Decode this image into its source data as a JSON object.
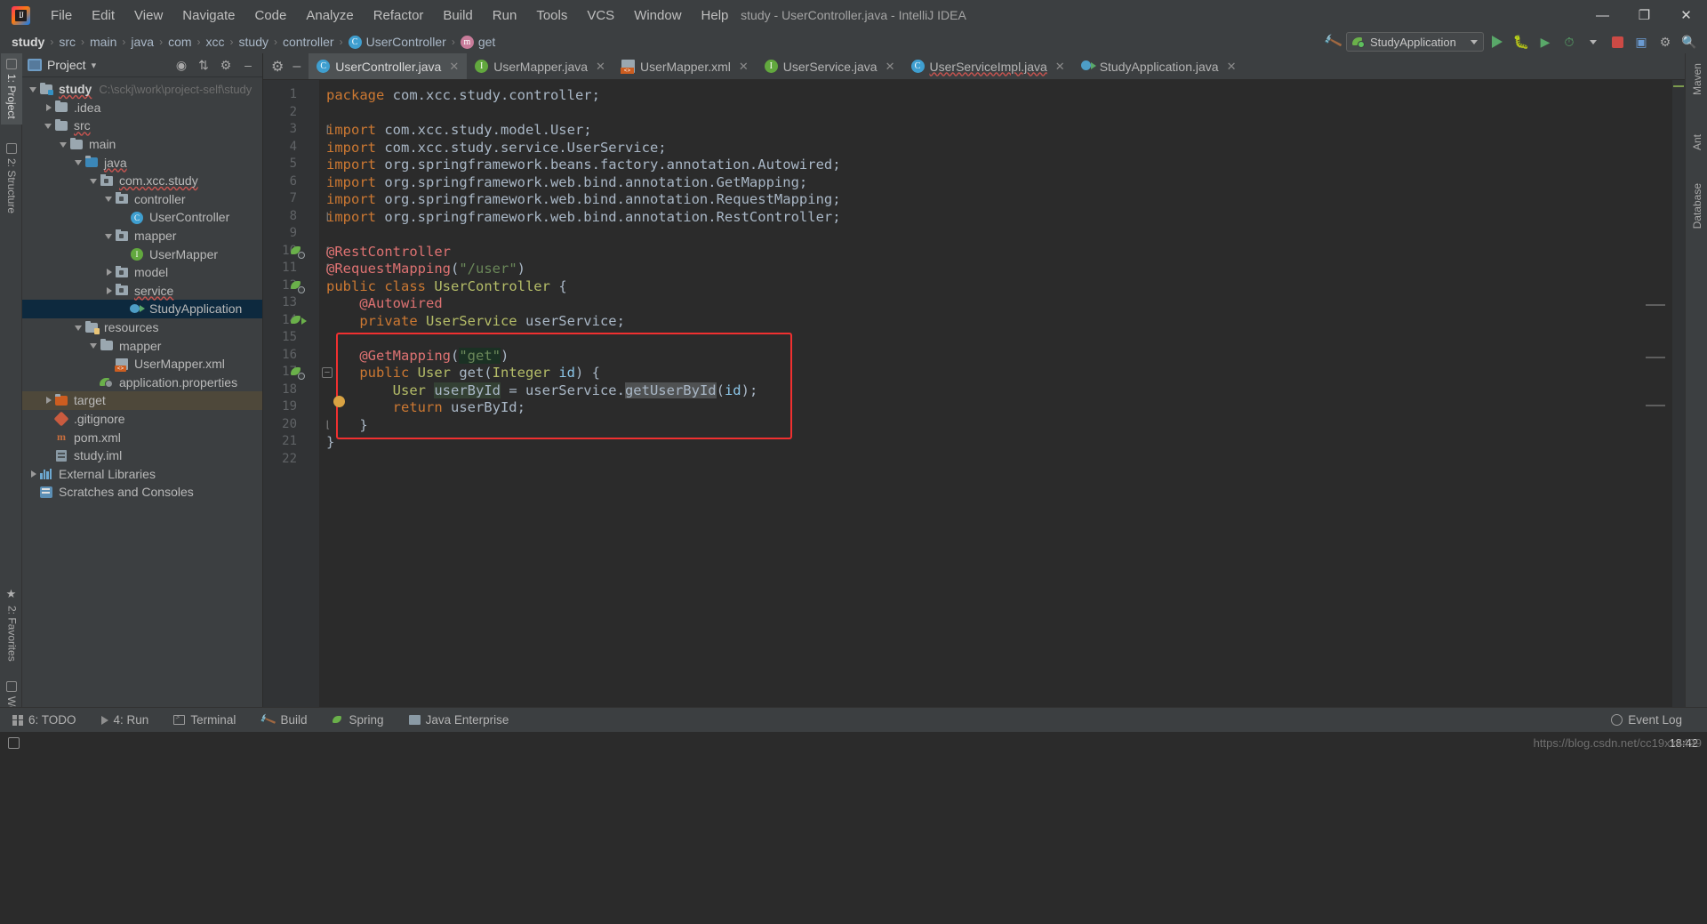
{
  "window": {
    "title": "study - UserController.java - IntelliJ IDEA",
    "logo_text": "IJ",
    "minimize": "—",
    "maximize": "❐",
    "close": "✕"
  },
  "menu": [
    {
      "label": "File"
    },
    {
      "label": "Edit"
    },
    {
      "label": "View"
    },
    {
      "label": "Navigate"
    },
    {
      "label": "Code"
    },
    {
      "label": "Analyze"
    },
    {
      "label": "Refactor"
    },
    {
      "label": "Build"
    },
    {
      "label": "Run"
    },
    {
      "label": "Tools"
    },
    {
      "label": "VCS"
    },
    {
      "label": "Window"
    },
    {
      "label": "Help"
    }
  ],
  "breadcrumb": {
    "separator": "›",
    "items": [
      {
        "label": "study",
        "icon": ""
      },
      {
        "label": "src",
        "icon": ""
      },
      {
        "label": "main",
        "icon": ""
      },
      {
        "label": "java",
        "icon": ""
      },
      {
        "label": "com",
        "icon": ""
      },
      {
        "label": "xcc",
        "icon": ""
      },
      {
        "label": "study",
        "icon": ""
      },
      {
        "label": "controller",
        "icon": ""
      },
      {
        "label": "UserController",
        "icon": "class-icon",
        "badge": "C"
      },
      {
        "label": "get",
        "icon": "method-icon",
        "badge": "m"
      }
    ]
  },
  "toolbar": {
    "build_hammer": "build-icon",
    "run_config": "StudyApplication",
    "run_label": "run-button",
    "debug_label": "debug-button",
    "coverage_label": "run-with-coverage-button",
    "profiler_label": "profiler-button",
    "stop_label": "stop-button",
    "updates_label": "update-button",
    "settings_label": "settings-button",
    "search_label": "search-everywhere-button"
  },
  "rails": {
    "left": [
      {
        "label": "1: Project",
        "active": true
      },
      {
        "label": "2: Structure",
        "active": false
      },
      {
        "label": "2: Favorites",
        "active": false
      },
      {
        "label": "Web",
        "active": false
      }
    ],
    "right": [
      {
        "label": "Maven",
        "active": false
      },
      {
        "label": "Ant",
        "active": false
      },
      {
        "label": "Database",
        "active": false
      }
    ]
  },
  "project_panel": {
    "title": "Project",
    "chevron": "▾",
    "actions": [
      "locate-icon",
      "collapse-all-icon",
      "settings-icon",
      "hide-icon"
    ],
    "tree": [
      {
        "indent": 0,
        "arrow": "open",
        "icon": "folder-module",
        "label": "study",
        "bold": true,
        "path": "C:\\sckj\\work\\project-self\\study",
        "wavy": true
      },
      {
        "indent": 1,
        "arrow": "closed",
        "icon": "folder",
        "label": ".idea"
      },
      {
        "indent": 1,
        "arrow": "open",
        "icon": "folder",
        "label": "src",
        "wavy": true
      },
      {
        "indent": 2,
        "arrow": "open",
        "icon": "folder",
        "label": "main"
      },
      {
        "indent": 3,
        "arrow": "open",
        "icon": "folder-source",
        "label": "java",
        "wavy": true
      },
      {
        "indent": 4,
        "arrow": "open",
        "icon": "package",
        "label": "com.xcc.study",
        "wavy": true
      },
      {
        "indent": 5,
        "arrow": "open",
        "icon": "package",
        "label": "controller"
      },
      {
        "indent": 6,
        "arrow": "none",
        "icon": "class",
        "label": "UserController"
      },
      {
        "indent": 5,
        "arrow": "open",
        "icon": "package",
        "label": "mapper"
      },
      {
        "indent": 6,
        "arrow": "none",
        "icon": "interface",
        "label": "UserMapper"
      },
      {
        "indent": 5,
        "arrow": "closed",
        "icon": "package",
        "label": "model"
      },
      {
        "indent": 5,
        "arrow": "closed",
        "icon": "package",
        "label": "service",
        "wavy": true
      },
      {
        "indent": 6,
        "arrow": "none",
        "icon": "spring-run",
        "label": "StudyApplication",
        "selected": true
      },
      {
        "indent": 3,
        "arrow": "open",
        "icon": "folder-resources",
        "label": "resources"
      },
      {
        "indent": 4,
        "arrow": "open",
        "icon": "folder",
        "label": "mapper"
      },
      {
        "indent": 5,
        "arrow": "none",
        "icon": "xml",
        "label": "UserMapper.xml"
      },
      {
        "indent": 4,
        "arrow": "none",
        "icon": "spring-config",
        "label": "application.properties"
      },
      {
        "indent": 1,
        "arrow": "closed",
        "icon": "folder-target",
        "label": "target",
        "target": true
      },
      {
        "indent": 1,
        "arrow": "none",
        "icon": "gitignore",
        "label": ".gitignore"
      },
      {
        "indent": 1,
        "arrow": "none",
        "icon": "maven",
        "label": "pom.xml"
      },
      {
        "indent": 1,
        "arrow": "none",
        "icon": "iml",
        "label": "study.iml"
      },
      {
        "indent": 0,
        "arrow": "closed",
        "icon": "libraries",
        "label": "External Libraries"
      },
      {
        "indent": 0,
        "arrow": "none",
        "icon": "scratches",
        "label": "Scratches and Consoles"
      }
    ]
  },
  "editor": {
    "tabs": [
      {
        "label": "UserController.java",
        "icon": "class",
        "active": true,
        "close": "✕"
      },
      {
        "label": "UserMapper.java",
        "icon": "interface",
        "active": false,
        "close": "✕"
      },
      {
        "label": "UserMapper.xml",
        "icon": "xml",
        "active": false,
        "close": "✕"
      },
      {
        "label": "UserService.java",
        "icon": "interface",
        "active": false,
        "close": "✕"
      },
      {
        "label": "UserServiceImpl.java",
        "icon": "class",
        "active": false,
        "wavy": true,
        "close": "✕"
      },
      {
        "label": "StudyApplication.java",
        "icon": "spring-run",
        "active": false,
        "close": "✕"
      }
    ],
    "tab_actions": [
      "settings-icon",
      "hide-icon"
    ],
    "line_numbers": [
      1,
      2,
      3,
      4,
      5,
      6,
      7,
      8,
      9,
      10,
      11,
      12,
      13,
      14,
      15,
      16,
      17,
      18,
      19,
      20,
      21,
      22
    ],
    "code": [
      {
        "n": 1,
        "tokens": [
          {
            "t": "package ",
            "c": "kw"
          },
          {
            "t": "com.xcc.study.controller;",
            "c": "plain"
          }
        ]
      },
      {
        "n": 2,
        "tokens": []
      },
      {
        "n": 3,
        "tokens": [
          {
            "t": "import ",
            "c": "kw"
          },
          {
            "t": "com.xcc.study.model.User;",
            "c": "plain"
          }
        ]
      },
      {
        "n": 4,
        "tokens": [
          {
            "t": "import ",
            "c": "kw"
          },
          {
            "t": "com.xcc.study.service.UserService;",
            "c": "plain"
          }
        ]
      },
      {
        "n": 5,
        "tokens": [
          {
            "t": "import ",
            "c": "kw"
          },
          {
            "t": "org.springframework.beans.factory.annotation.Autowired;",
            "c": "plain"
          }
        ]
      },
      {
        "n": 6,
        "tokens": [
          {
            "t": "import ",
            "c": "kw"
          },
          {
            "t": "org.springframework.web.bind.annotation.GetMapping;",
            "c": "plain"
          }
        ]
      },
      {
        "n": 7,
        "tokens": [
          {
            "t": "import ",
            "c": "kw"
          },
          {
            "t": "org.springframework.web.bind.annotation.RequestMapping;",
            "c": "plain"
          }
        ]
      },
      {
        "n": 8,
        "tokens": [
          {
            "t": "import ",
            "c": "kw"
          },
          {
            "t": "org.springframework.web.bind.annotation.RestController;",
            "c": "plain"
          }
        ]
      },
      {
        "n": 9,
        "tokens": []
      },
      {
        "n": 10,
        "tokens": [
          {
            "t": "@RestController",
            "c": "anno"
          }
        ]
      },
      {
        "n": 11,
        "tokens": [
          {
            "t": "@RequestMapping",
            "c": "anno"
          },
          {
            "t": "(",
            "c": "plain"
          },
          {
            "t": "\"/user\"",
            "c": "str"
          },
          {
            "t": ")",
            "c": "plain"
          }
        ]
      },
      {
        "n": 12,
        "tokens": [
          {
            "t": "public class ",
            "c": "kw"
          },
          {
            "t": "UserController",
            "c": "cls"
          },
          {
            "t": " {",
            "c": "plain"
          }
        ]
      },
      {
        "n": 13,
        "tokens": [
          {
            "t": "    @Autowired",
            "c": "anno"
          }
        ]
      },
      {
        "n": 14,
        "tokens": [
          {
            "t": "    private ",
            "c": "kw"
          },
          {
            "t": "UserService",
            "c": "cls"
          },
          {
            "t": " userService;",
            "c": "plain"
          }
        ]
      },
      {
        "n": 15,
        "tokens": []
      },
      {
        "n": 16,
        "tokens": [
          {
            "t": "    @GetMapping",
            "c": "anno"
          },
          {
            "t": "(",
            "c": "plain"
          },
          {
            "t": "\"get\"",
            "c": "str-hl"
          },
          {
            "t": ")",
            "c": "plain"
          }
        ]
      },
      {
        "n": 17,
        "tokens": [
          {
            "t": "    public ",
            "c": "kw"
          },
          {
            "t": "User",
            "c": "cls"
          },
          {
            "t": " get(",
            "c": "plain"
          },
          {
            "t": "Integer",
            "c": "cls"
          },
          {
            "t": " ",
            "c": "plain"
          },
          {
            "t": "id",
            "c": "param"
          },
          {
            "t": ") {",
            "c": "plain"
          }
        ]
      },
      {
        "n": 18,
        "tokens": [
          {
            "t": "        ",
            "c": "plain"
          },
          {
            "t": "User",
            "c": "cls"
          },
          {
            "t": " ",
            "c": "plain"
          },
          {
            "t": "userById",
            "c": "var-hl"
          },
          {
            "t": " = userService.",
            "c": "plain"
          },
          {
            "t": "getUserById",
            "c": "meth-hl"
          },
          {
            "t": "(",
            "c": "plain"
          },
          {
            "t": "id",
            "c": "param"
          },
          {
            "t": ");",
            "c": "plain"
          }
        ]
      },
      {
        "n": 19,
        "tokens": [
          {
            "t": "        return ",
            "c": "kw"
          },
          {
            "t": "userById;",
            "c": "plain"
          }
        ]
      },
      {
        "n": 20,
        "tokens": [
          {
            "t": "    }",
            "c": "plain"
          }
        ]
      },
      {
        "n": 21,
        "tokens": [
          {
            "t": "}",
            "c": "plain"
          }
        ]
      },
      {
        "n": 22,
        "tokens": []
      }
    ],
    "highlight_box": {
      "from_line": 15,
      "to_line": 20,
      "color": "#f03030"
    },
    "gutter_icons": [
      {
        "line": 10,
        "type": "spring-bean-icon"
      },
      {
        "line": 12,
        "type": "spring-bean-icon"
      },
      {
        "line": 14,
        "type": "spring-autowired-icon"
      },
      {
        "line": 17,
        "type": "spring-mapping-icon"
      },
      {
        "line": 18,
        "type": "intention-bulb-icon"
      }
    ]
  },
  "bottom_bar": {
    "items": [
      {
        "label": "6: TODO",
        "icon": "todo-icon"
      },
      {
        "label": "4: Run",
        "icon": "run-icon"
      },
      {
        "label": "Terminal",
        "icon": "terminal-icon"
      },
      {
        "label": "Build",
        "icon": "build-icon"
      },
      {
        "label": "Spring",
        "icon": "spring-icon"
      },
      {
        "label": "Java Enterprise",
        "icon": "java-enterprise-icon"
      }
    ],
    "event_log": {
      "label": "Event Log",
      "icon": "event-log-icon"
    }
  },
  "status_bar": {
    "time": "18:42",
    "watermark": "https://blog.csdn.net/cc19xx4499"
  }
}
